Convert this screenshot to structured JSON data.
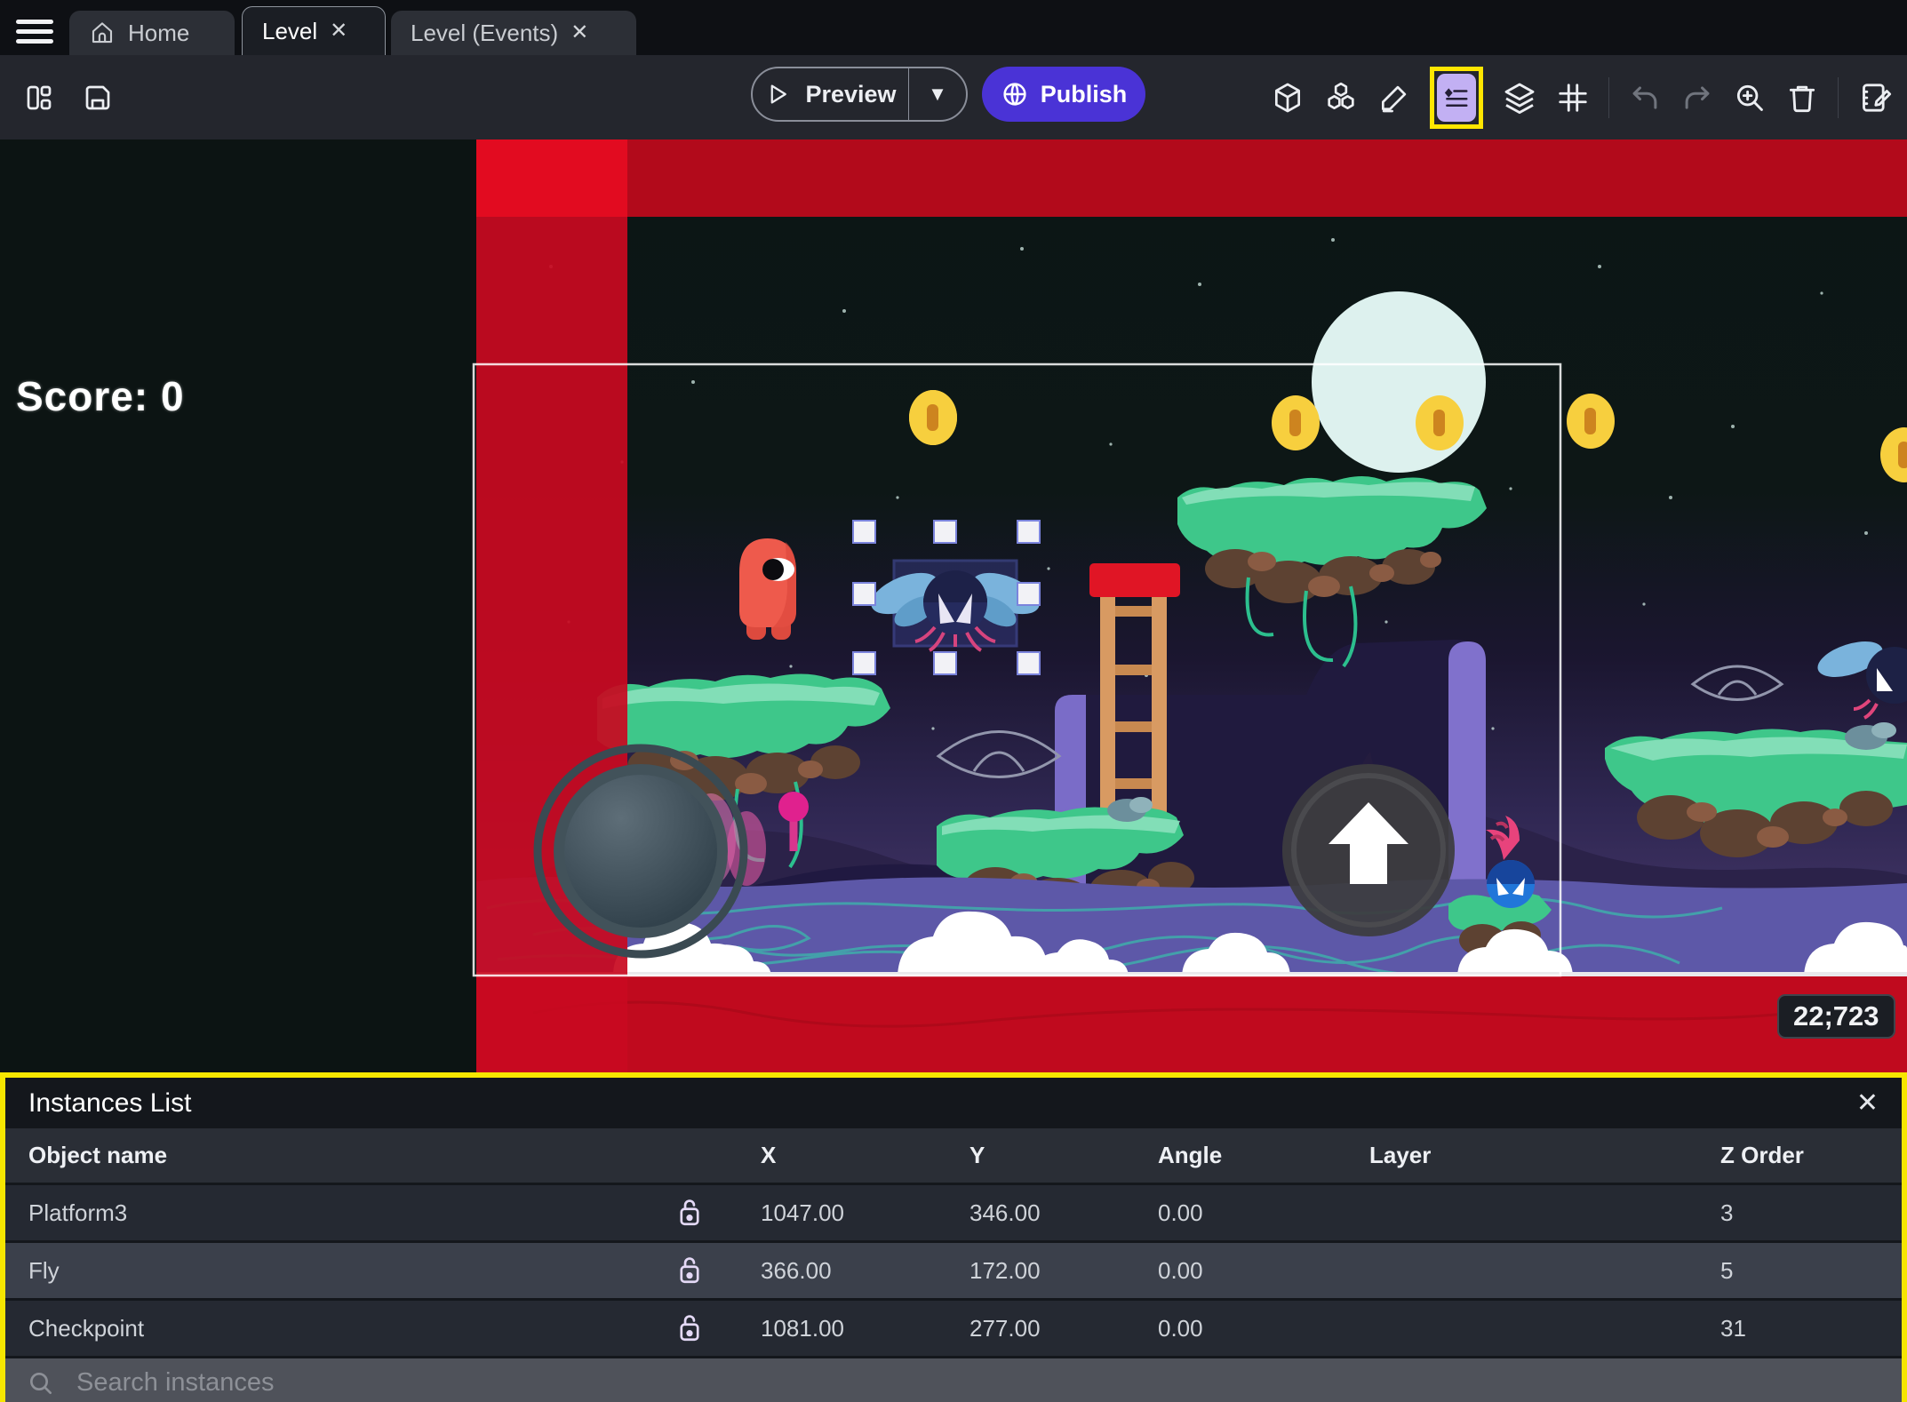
{
  "tabs": {
    "home": "Home",
    "level": "Level",
    "level_events": "Level (Events)",
    "close_glyph": "✕"
  },
  "toolbar": {
    "preview_label": "Preview",
    "publish_label": "Publish",
    "caret_glyph": "▼",
    "icon_names": [
      "panels-icon",
      "save-icon",
      "cube-3d-icon",
      "objects-icon",
      "edit-scene-icon",
      "instances-list-icon",
      "layers-icon",
      "grid-icon",
      "undo-icon",
      "redo-icon",
      "zoom-in-icon",
      "delete-icon",
      "edit-properties-icon"
    ]
  },
  "game": {
    "score_label": "Score: 0",
    "coordinates_badge": "22;723"
  },
  "instances_panel": {
    "title": "Instances List",
    "close_glyph": "✕",
    "columns": [
      "Object name",
      "X",
      "Y",
      "Angle",
      "Layer",
      "Z Order"
    ],
    "rows": [
      {
        "name": "Platform3",
        "x": "1047.00",
        "y": "346.00",
        "angle": "0.00",
        "layer": "",
        "z_order": "3"
      },
      {
        "name": "Fly",
        "x": "366.00",
        "y": "172.00",
        "angle": "0.00",
        "layer": "",
        "z_order": "5"
      },
      {
        "name": "Checkpoint",
        "x": "1081.00",
        "y": "277.00",
        "angle": "0.00",
        "layer": "",
        "z_order": "31"
      }
    ],
    "search_placeholder": "Search instances"
  },
  "colors": {
    "accent_purple": "#4a33d6",
    "highlight_yellow": "#ffe600",
    "boundary_red": "#c50a20",
    "selected_row": "#3b404b",
    "instances_icon_bg": "#c2b0f3"
  }
}
